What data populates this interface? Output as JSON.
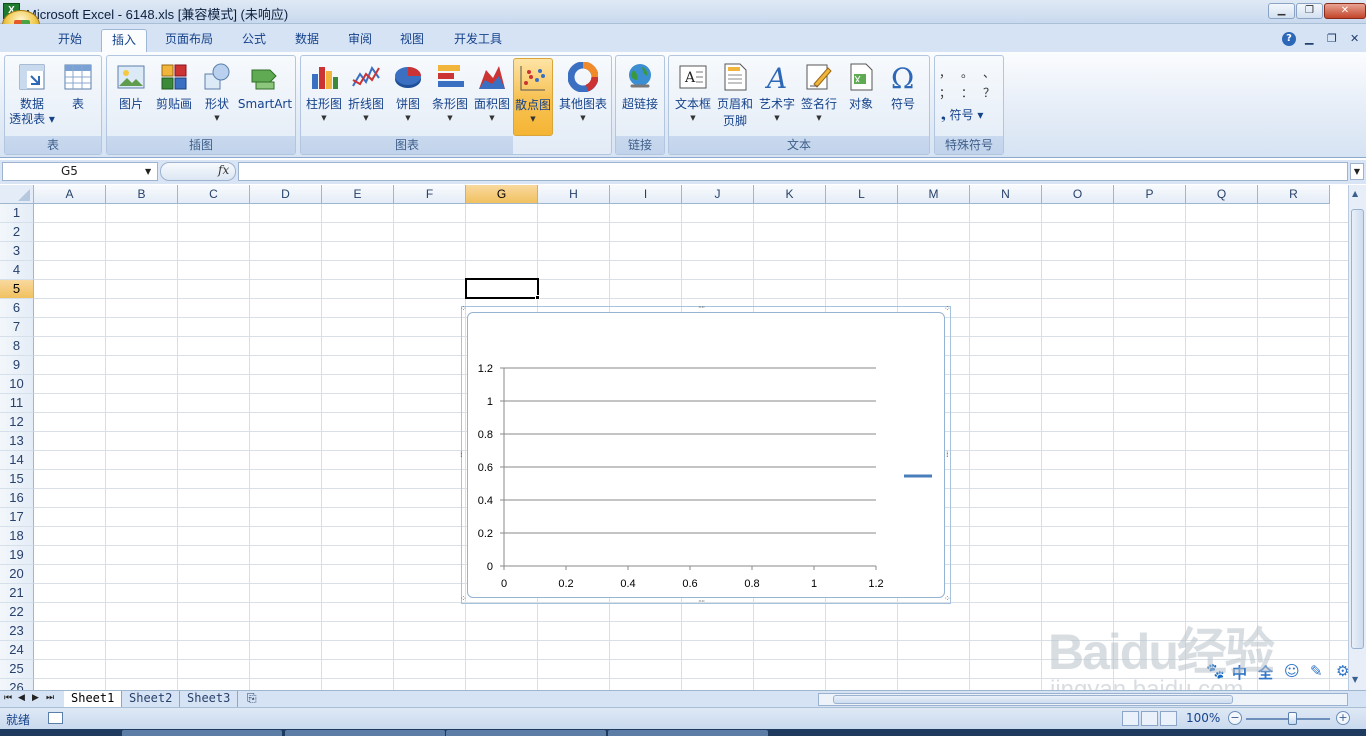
{
  "window": {
    "title": "Microsoft Excel - 6148.xls  [兼容模式] (未响应)",
    "app_icon_letter": "X"
  },
  "tabs": [
    {
      "label": "开始"
    },
    {
      "label": "插入",
      "active": true
    },
    {
      "label": "页面布局"
    },
    {
      "label": "公式"
    },
    {
      "label": "数据"
    },
    {
      "label": "审阅"
    },
    {
      "label": "视图"
    },
    {
      "label": "开发工具"
    }
  ],
  "ribbon": {
    "groups": {
      "table": "表",
      "illustrations": "插图",
      "charts": "图表",
      "links": "链接",
      "text": "文本",
      "special_symbols": "特殊符号"
    },
    "buttons": {
      "pivot": [
        "数据",
        "透视表"
      ],
      "table": "表",
      "picture": "图片",
      "clipart": "剪贴画",
      "shapes": "形状",
      "smartart": "SmartArt",
      "column": "柱形图",
      "line": "折线图",
      "pie": "饼图",
      "bar": "条形图",
      "area": "面积图",
      "scatter": "散点图",
      "other_charts": "其他图表",
      "hyperlink": "超链接",
      "textbox": "文本框",
      "header_footer": [
        "页眉和",
        "页脚"
      ],
      "wordart": "艺术字",
      "signature": "签名行",
      "object": "对象",
      "symbol": "符号",
      "symbol_dropdown": "符号"
    },
    "symbol_chars": [
      "，",
      "。",
      "、",
      "；",
      "：",
      "？"
    ]
  },
  "formula_bar": {
    "name_box": "G5",
    "fx": "fx",
    "value": ""
  },
  "grid": {
    "columns": [
      "A",
      "B",
      "C",
      "D",
      "E",
      "F",
      "G",
      "H",
      "I",
      "J",
      "K",
      "L",
      "M",
      "N",
      "O",
      "P",
      "Q",
      "R"
    ],
    "rows": [
      "1",
      "2",
      "3",
      "4",
      "5",
      "6",
      "7",
      "8",
      "9",
      "10",
      "11",
      "12",
      "13",
      "14",
      "15",
      "16",
      "17",
      "18",
      "19",
      "20",
      "21",
      "22",
      "23",
      "24",
      "25",
      "26"
    ],
    "selected_cell": "G5",
    "selected_column": "G",
    "selected_row": "5"
  },
  "chart_data": {
    "type": "scatter",
    "title": "",
    "xlabel": "",
    "ylabel": "",
    "x_ticks": [
      "0",
      "0.2",
      "0.4",
      "0.6",
      "0.8",
      "1",
      "1.2"
    ],
    "y_ticks": [
      "0",
      "0.2",
      "0.4",
      "0.6",
      "0.8",
      "1",
      "1.2"
    ],
    "xlim": [
      0,
      1.2
    ],
    "ylim": [
      0,
      1.2
    ],
    "grid": true,
    "legend_placement": "right",
    "series": [],
    "legend_color": "#4a7ebb"
  },
  "sheets": [
    {
      "label": "Sheet1",
      "active": true
    },
    {
      "label": "Sheet2"
    },
    {
      "label": "Sheet3"
    }
  ],
  "status": {
    "text": "就绪",
    "zoom": "100%",
    "zoom_minus": "−",
    "zoom_plus": "+"
  },
  "ime": [
    "中",
    "全"
  ],
  "watermark": {
    "logo": "Baidu经验",
    "url": "jingyan.baidu.com"
  },
  "colors": {
    "accent": "#15428b",
    "selected": "#f1c15f",
    "series": "#4a7ebb"
  }
}
